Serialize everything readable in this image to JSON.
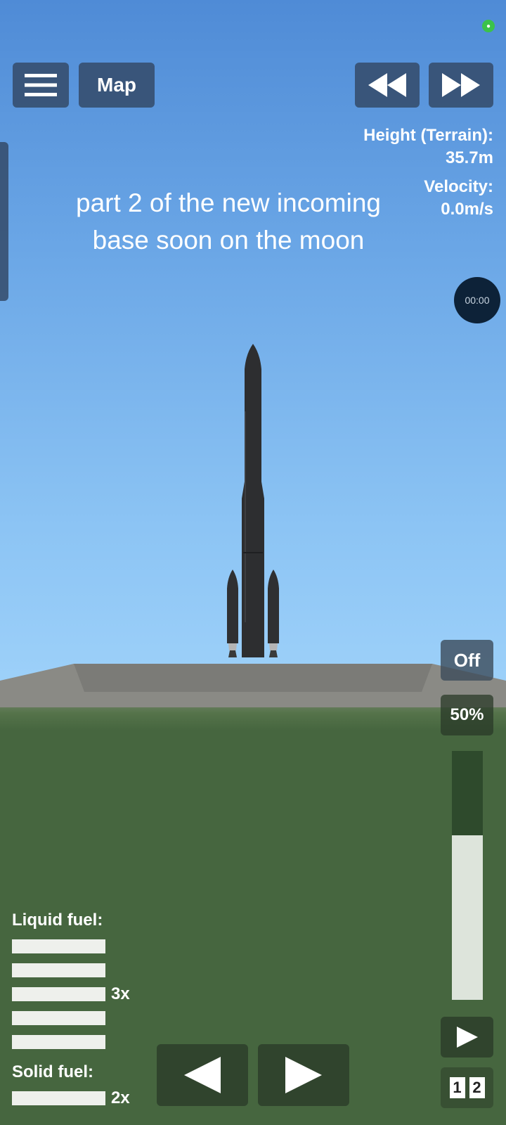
{
  "toolbar": {
    "map_label": "Map",
    "menu_icon": "hamburger-icon",
    "rewind_icon": "rewind-icon",
    "fastforward_icon": "fast-forward-icon"
  },
  "telemetry": {
    "height_label": "Height (Terrain):",
    "height_value": "35.7m",
    "velocity_label": "Velocity:",
    "velocity_value": "0.0m/s"
  },
  "caption": {
    "line1": "part 2 of the new incoming",
    "line2": "base soon on the moon"
  },
  "recorder": {
    "time": "00:00"
  },
  "controls": {
    "rcs_label": "Off",
    "throttle_label": "50%",
    "throttle_fraction": 0.66,
    "play_icon": "play-icon",
    "stage_a": "1",
    "stage_b": "2",
    "rotate_left_icon": "triangle-left-icon",
    "rotate_right_icon": "triangle-right-icon"
  },
  "fuel": {
    "liquid_label": "Liquid fuel:",
    "liquid_multiplier": "3x",
    "solid_label": "Solid fuel:",
    "solid_multiplier": "2x"
  },
  "colors": {
    "sky_top": "#4f8bd6",
    "ground": "#46663f",
    "button_bg": "#344a68"
  }
}
